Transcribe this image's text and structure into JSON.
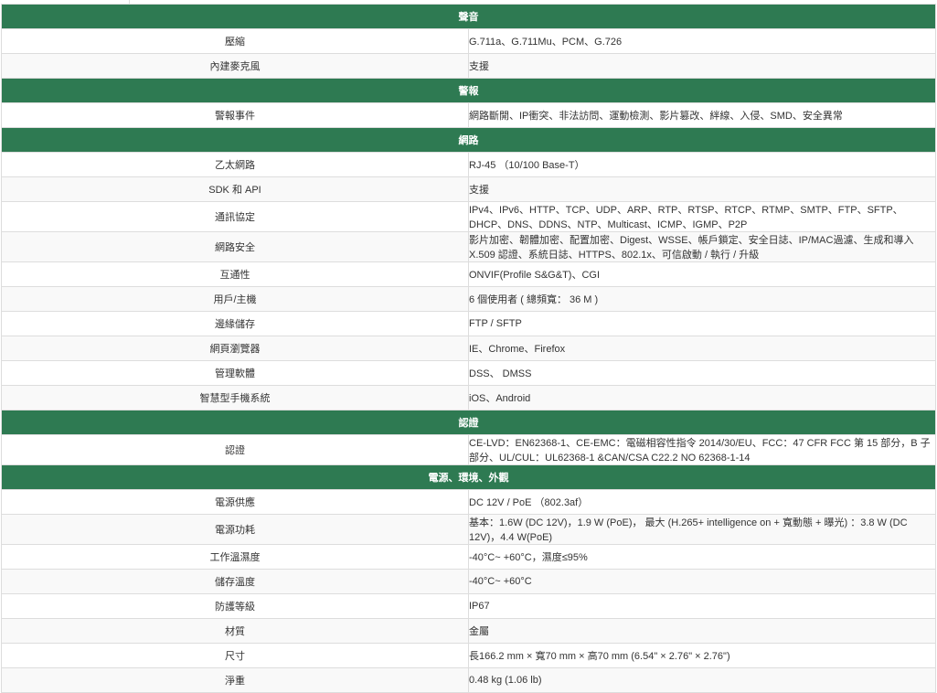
{
  "sections": [
    {
      "title": "聲音",
      "rows": [
        {
          "label": "壓縮",
          "value": "G.711a、G.711Mu、PCM、G.726"
        },
        {
          "label": "內建麥克風",
          "value": "支援"
        }
      ]
    },
    {
      "title": "警報",
      "rows": [
        {
          "label": "警報事件",
          "value": "網路斷開、IP衝突、非法訪問、運動檢測、影片篡改、絆線、入侵、SMD、安全異常"
        }
      ]
    },
    {
      "title": "網路",
      "rows": [
        {
          "label": "乙太網路",
          "value": "RJ-45 （10/100 Base-T）"
        },
        {
          "label": "SDK 和 API",
          "value": "支援"
        },
        {
          "label": "通訊協定",
          "value": "IPv4、IPv6、HTTP、TCP、UDP、ARP、RTP、RTSP、RTCP、RTMP、SMTP、FTP、SFTP、DHCP、DNS、DDNS、NTP、Multicast、ICMP、IGMP、P2P"
        },
        {
          "label": "網路安全",
          "value": "影片加密、韌體加密、配置加密、Digest、WSSE、帳戶鎖定、安全日誌、IP/MAC過濾、生成和導入 X.509 認證、系統日誌、HTTPS、802.1x、可信啟動 / 執行 / 升級"
        },
        {
          "label": "互通性",
          "value": "ONVIF(Profile S&G&T)、CGI"
        },
        {
          "label": "用戶/主機",
          "value": "6 個使用者 ( 總頻寬： 36 M )"
        },
        {
          "label": "邊緣儲存",
          "value": "FTP / SFTP"
        },
        {
          "label": "網頁瀏覽器",
          "value": "IE、Chrome、Firefox"
        },
        {
          "label": "管理軟體",
          "value": "DSS、 DMSS"
        },
        {
          "label": "智慧型手機系統",
          "value": "iOS、Android"
        }
      ]
    },
    {
      "title": "認證",
      "rows": [
        {
          "label": "認證",
          "value": "CE-LVD：EN62368-1、CE-EMC：電磁相容性指令 2014/30/EU、FCC：47 CFR FCC 第 15 部分，B 子部分、UL/CUL：UL62368-1 &CAN/CSA C22.2 NO 62368-1-14"
        }
      ]
    },
    {
      "title": "電源、環境、外觀",
      "rows": [
        {
          "label": "電源供應",
          "value": "DC 12V / PoE （802.3af）"
        },
        {
          "label": "電源功耗",
          "value": "基本：1.6W (DC 12V)，1.9 W (PoE)， 最大 (H.265+ intelligence on + 寬動態 + 曝光) ：3.8 W (DC 12V)，4.4 W(PoE)"
        },
        {
          "label": "工作溫濕度",
          "value": "-40°C~ +60°C，濕度≤95%"
        },
        {
          "label": "儲存溫度",
          "value": "-40°C~ +60°C"
        },
        {
          "label": "防護等級",
          "value": "IP67"
        },
        {
          "label": "材質",
          "value": "金屬"
        },
        {
          "label": "尺寸",
          "value": "長166.2 mm × 寬70 mm × 高70 mm (6.54\" × 2.76\" × 2.76\")"
        },
        {
          "label": "淨重",
          "value": "0.48 kg (1.06 lb)"
        }
      ]
    }
  ]
}
